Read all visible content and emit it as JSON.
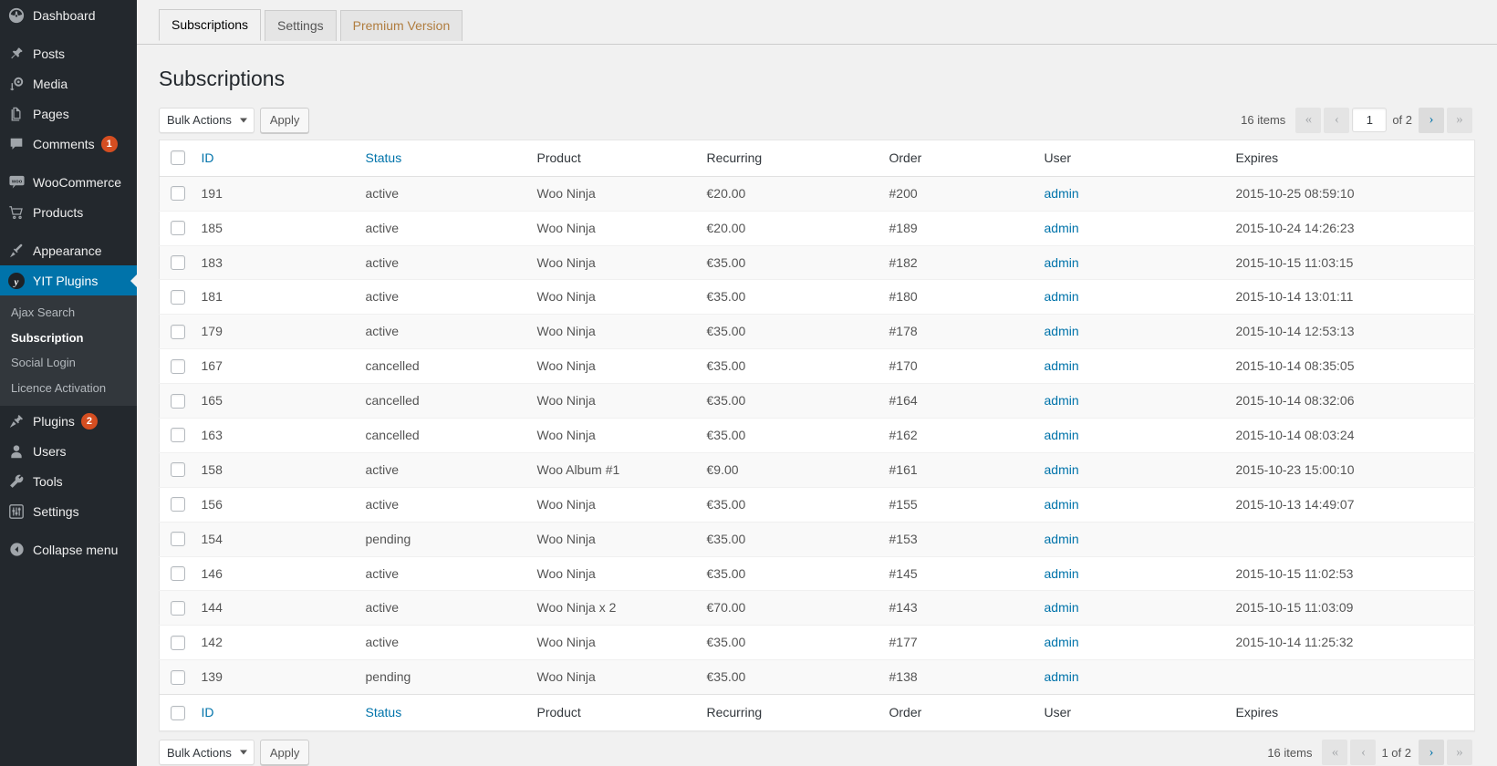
{
  "sidebar": {
    "items": [
      {
        "label": "Dashboard",
        "icon": "dashboard-icon",
        "name": "sidebar-item-dashboard",
        "badge": null
      },
      {
        "sep": true
      },
      {
        "label": "Posts",
        "icon": "pin-icon",
        "name": "sidebar-item-posts",
        "badge": null
      },
      {
        "label": "Media",
        "icon": "media-icon",
        "name": "sidebar-item-media",
        "badge": null
      },
      {
        "label": "Pages",
        "icon": "pages-icon",
        "name": "sidebar-item-pages",
        "badge": null
      },
      {
        "label": "Comments",
        "icon": "comment-icon",
        "name": "sidebar-item-comments",
        "badge": "1"
      },
      {
        "sep": true
      },
      {
        "label": "WooCommerce",
        "icon": "woocommerce-icon",
        "name": "sidebar-item-woocommerce",
        "badge": null
      },
      {
        "label": "Products",
        "icon": "cart-icon",
        "name": "sidebar-item-products",
        "badge": null
      },
      {
        "sep": true
      },
      {
        "label": "Appearance",
        "icon": "brush-icon",
        "name": "sidebar-item-appearance",
        "badge": null
      },
      {
        "label": "YIT Plugins",
        "icon": "yit-icon",
        "name": "sidebar-item-yit-plugins",
        "badge": null,
        "current": true
      }
    ],
    "submenu": [
      {
        "label": "Ajax Search",
        "name": "submenu-item-ajax-search",
        "active": false
      },
      {
        "label": "Subscription",
        "name": "submenu-item-subscription",
        "active": true
      },
      {
        "label": "Social Login",
        "name": "submenu-item-social-login",
        "active": false
      },
      {
        "label": "Licence Activation",
        "name": "submenu-item-licence-activation",
        "active": false
      }
    ],
    "items_after": [
      {
        "label": "Plugins",
        "icon": "plug-icon",
        "name": "sidebar-item-plugins",
        "badge": "2"
      },
      {
        "label": "Users",
        "icon": "user-icon",
        "name": "sidebar-item-users",
        "badge": null
      },
      {
        "label": "Tools",
        "icon": "wrench-icon",
        "name": "sidebar-item-tools",
        "badge": null
      },
      {
        "label": "Settings",
        "icon": "sliders-icon",
        "name": "sidebar-item-settings",
        "badge": null
      },
      {
        "sep": true
      },
      {
        "label": "Collapse menu",
        "icon": "collapse-icon",
        "name": "sidebar-item-collapse-menu",
        "badge": null
      }
    ]
  },
  "tabs": [
    {
      "label": "Subscriptions",
      "active": true
    },
    {
      "label": "Settings",
      "active": false
    },
    {
      "label": "Premium Version",
      "active": false,
      "premium": true
    }
  ],
  "page": {
    "title": "Subscriptions"
  },
  "toolbar": {
    "bulk_actions_label": "Bulk Actions",
    "apply_label": "Apply"
  },
  "pagination_top": {
    "count": "16 items",
    "first": "«",
    "prev": "‹",
    "current_page": "1",
    "total_label": "of 2",
    "next": "›",
    "last": "»"
  },
  "pagination_bottom": {
    "count": "16 items",
    "first": "«",
    "prev": "‹",
    "page_text": "1 of 2",
    "next": "›",
    "last": "»"
  },
  "table": {
    "columns": [
      {
        "label": "ID",
        "link": true,
        "cls": "col-id"
      },
      {
        "label": "Status",
        "link": true,
        "cls": "col-status"
      },
      {
        "label": "Product",
        "link": false,
        "cls": "col-product"
      },
      {
        "label": "Recurring",
        "link": false,
        "cls": "col-recurring"
      },
      {
        "label": "Order",
        "link": false,
        "cls": "col-order"
      },
      {
        "label": "User",
        "link": false,
        "cls": "col-user"
      },
      {
        "label": "Expires",
        "link": false,
        "cls": "col-expires"
      }
    ],
    "rows": [
      {
        "id": "191",
        "status": "active",
        "product": "Woo Ninja",
        "recurring": "€20.00",
        "order": "#200",
        "user": "admin",
        "expires": "2015-10-25 08:59:10"
      },
      {
        "id": "185",
        "status": "active",
        "product": "Woo Ninja",
        "recurring": "€20.00",
        "order": "#189",
        "user": "admin",
        "expires": "2015-10-24 14:26:23"
      },
      {
        "id": "183",
        "status": "active",
        "product": "Woo Ninja",
        "recurring": "€35.00",
        "order": "#182",
        "user": "admin",
        "expires": "2015-10-15 11:03:15"
      },
      {
        "id": "181",
        "status": "active",
        "product": "Woo Ninja",
        "recurring": "€35.00",
        "order": "#180",
        "user": "admin",
        "expires": "2015-10-14 13:01:11"
      },
      {
        "id": "179",
        "status": "active",
        "product": "Woo Ninja",
        "recurring": "€35.00",
        "order": "#178",
        "user": "admin",
        "expires": "2015-10-14 12:53:13"
      },
      {
        "id": "167",
        "status": "cancelled",
        "product": "Woo Ninja",
        "recurring": "€35.00",
        "order": "#170",
        "user": "admin",
        "expires": "2015-10-14 08:35:05"
      },
      {
        "id": "165",
        "status": "cancelled",
        "product": "Woo Ninja",
        "recurring": "€35.00",
        "order": "#164",
        "user": "admin",
        "expires": "2015-10-14 08:32:06"
      },
      {
        "id": "163",
        "status": "cancelled",
        "product": "Woo Ninja",
        "recurring": "€35.00",
        "order": "#162",
        "user": "admin",
        "expires": "2015-10-14 08:03:24"
      },
      {
        "id": "158",
        "status": "active",
        "product": "Woo Album #1",
        "recurring": "€9.00",
        "order": "#161",
        "user": "admin",
        "expires": "2015-10-23 15:00:10"
      },
      {
        "id": "156",
        "status": "active",
        "product": "Woo Ninja",
        "recurring": "€35.00",
        "order": "#155",
        "user": "admin",
        "expires": "2015-10-13 14:49:07"
      },
      {
        "id": "154",
        "status": "pending",
        "product": "Woo Ninja",
        "recurring": "€35.00",
        "order": "#153",
        "user": "admin",
        "expires": ""
      },
      {
        "id": "146",
        "status": "active",
        "product": "Woo Ninja",
        "recurring": "€35.00",
        "order": "#145",
        "user": "admin",
        "expires": "2015-10-15 11:02:53"
      },
      {
        "id": "144",
        "status": "active",
        "product": "Woo Ninja x 2",
        "recurring": "€70.00",
        "order": "#143",
        "user": "admin",
        "expires": "2015-10-15 11:03:09"
      },
      {
        "id": "142",
        "status": "active",
        "product": "Woo Ninja",
        "recurring": "€35.00",
        "order": "#177",
        "user": "admin",
        "expires": "2015-10-14 11:25:32"
      },
      {
        "id": "139",
        "status": "pending",
        "product": "Woo Ninja",
        "recurring": "€35.00",
        "order": "#138",
        "user": "admin",
        "expires": ""
      }
    ]
  },
  "colors": {
    "accent": "#0073aa",
    "sidebar_bg": "#23282d",
    "submenu_bg": "#32373c",
    "badge": "#d54e21",
    "premium_tab": "#b07d3f"
  }
}
